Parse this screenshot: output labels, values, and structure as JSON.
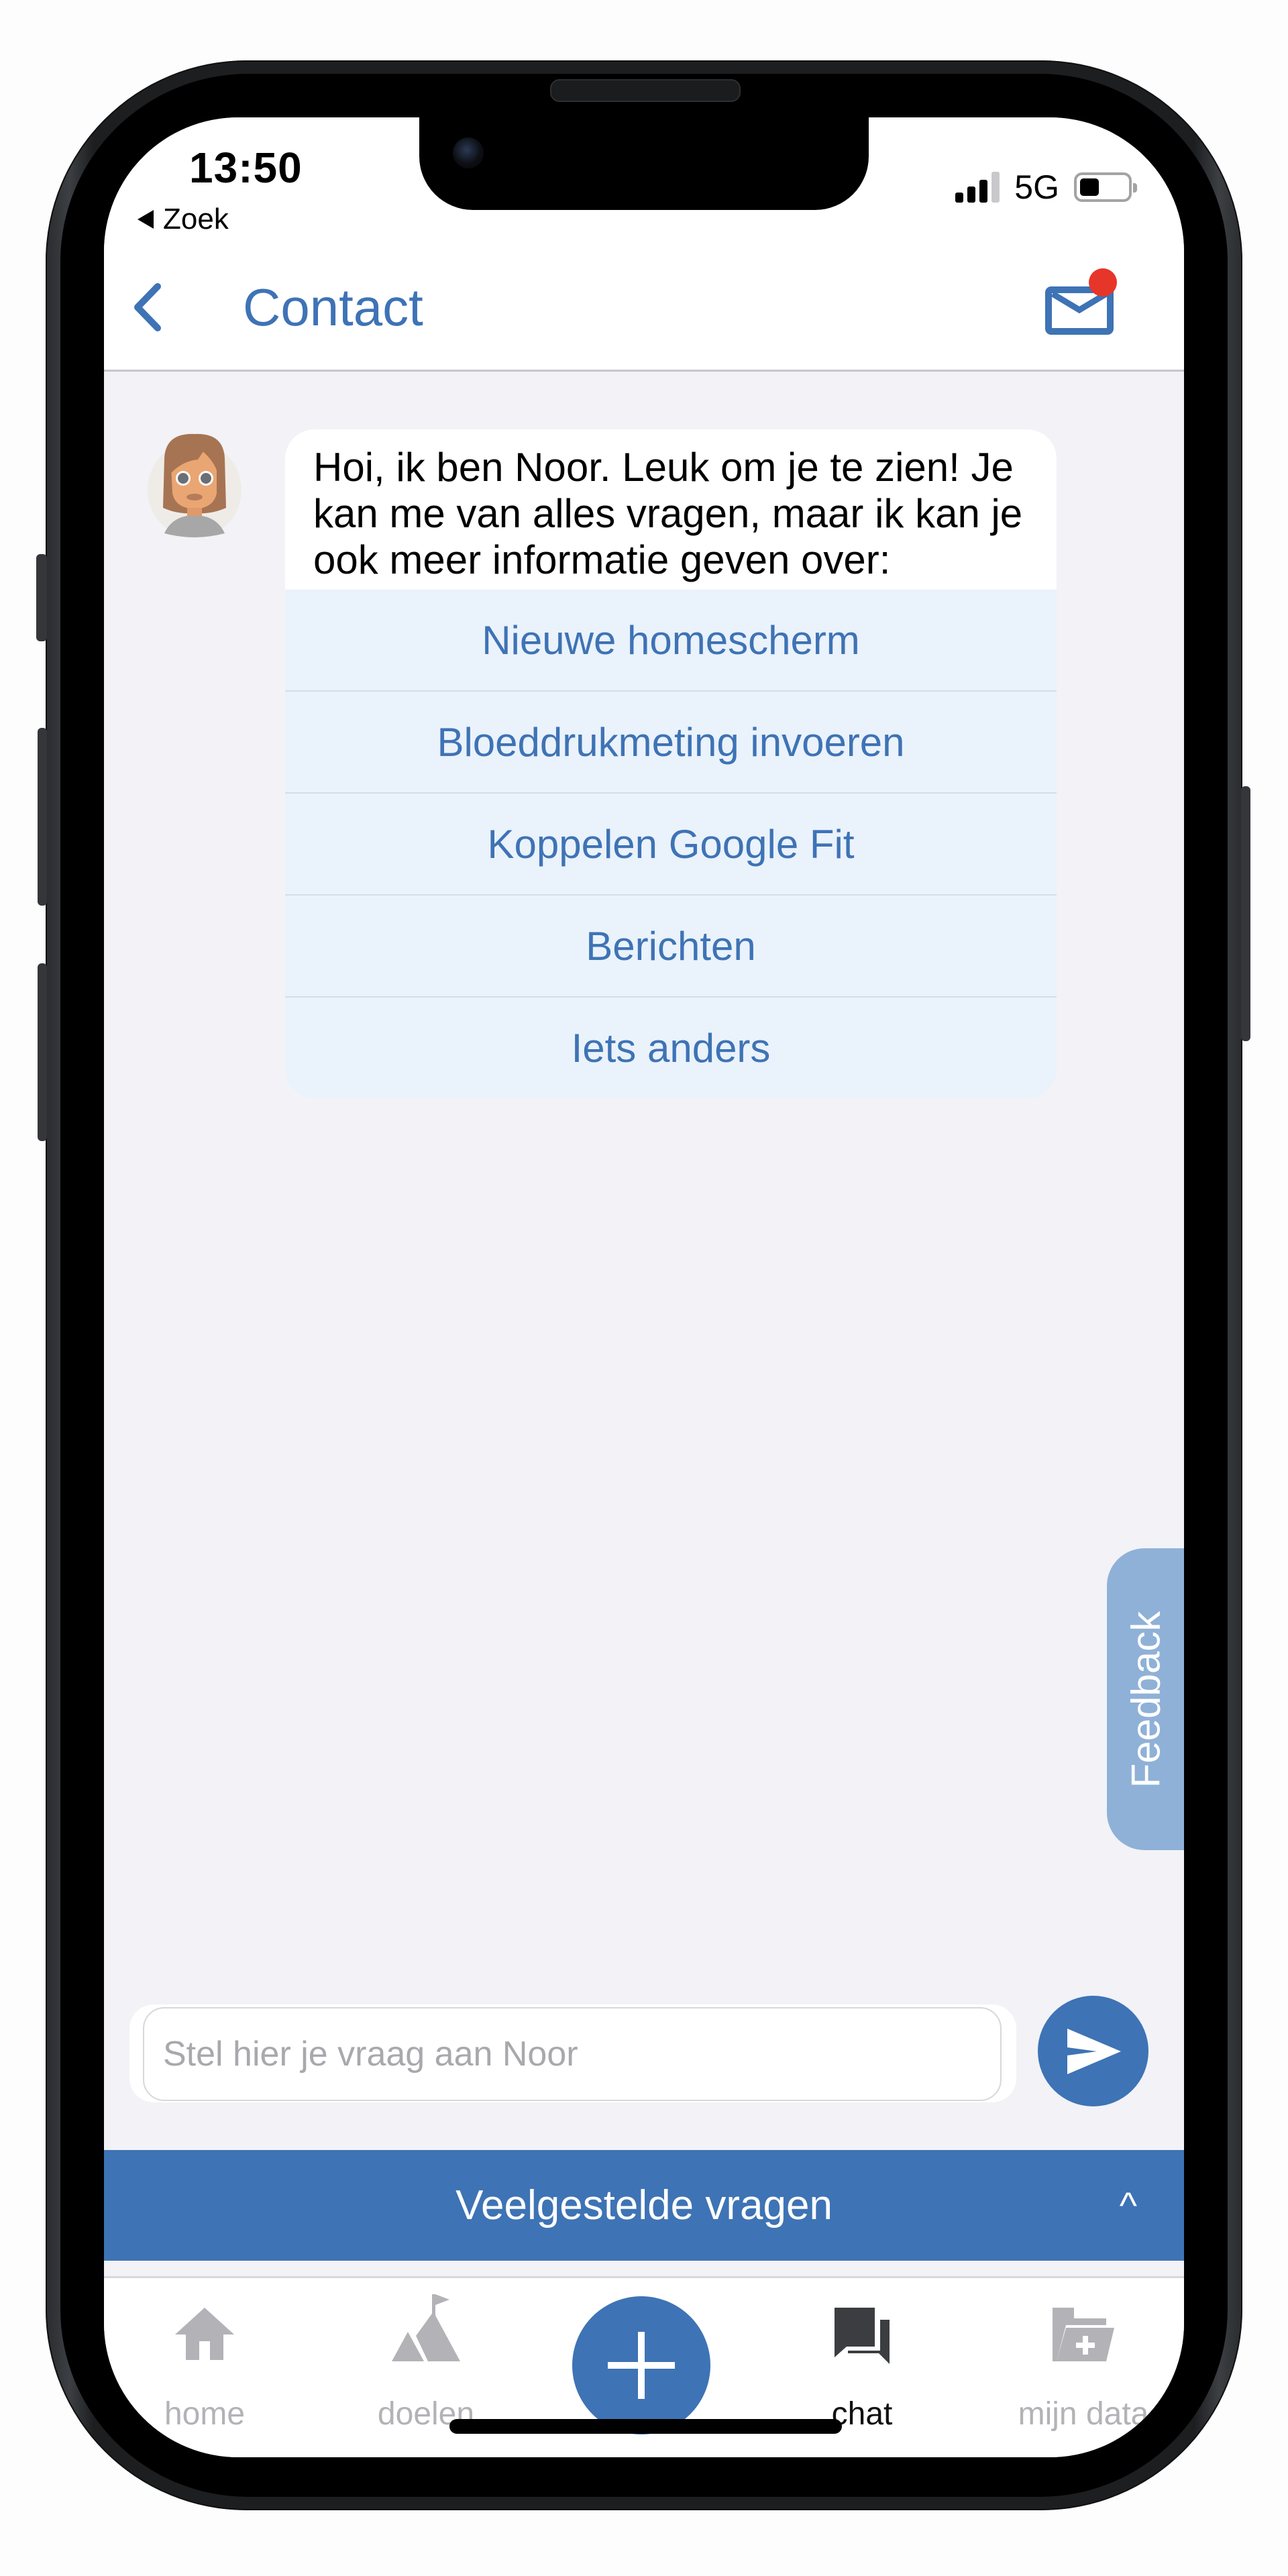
{
  "status_bar": {
    "time": "13:50",
    "back_app_label": "Zoek",
    "network": "5G",
    "signal_bars_active": 3,
    "signal_bars_total": 4,
    "battery_level_fraction": 0.4
  },
  "header": {
    "title": "Contact",
    "back_icon": "chevron-left-icon",
    "mail_icon": "mail-icon",
    "mail_has_notification": true
  },
  "chat": {
    "bot_name": "Noor",
    "messages": [
      {
        "sender": "bot",
        "text": "Hoi, ik ben Noor. Leuk om je te zien! Je kan me van alles vragen, maar ik kan je ook meer informatie geven over:",
        "options": [
          {
            "label": "Nieuwe homescherm"
          },
          {
            "label": "Bloeddrukmeting invoeren"
          },
          {
            "label": "Koppelen Google Fit"
          },
          {
            "label": "Berichten"
          },
          {
            "label": "Iets anders"
          }
        ]
      }
    ],
    "feedback_label": "Feedback",
    "input": {
      "value": "",
      "placeholder": "Stel hier je vraag aan Noor"
    },
    "send_icon": "send-icon"
  },
  "faq": {
    "label": "Veelgestelde vragen",
    "chevron": "^"
  },
  "tab_bar": {
    "items": [
      {
        "label": "home",
        "icon": "home-icon",
        "active": false
      },
      {
        "label": "doelen",
        "icon": "mountain-flag-icon",
        "active": false
      },
      {
        "label": "",
        "icon": "plus-icon",
        "active": false
      },
      {
        "label": "chat",
        "icon": "chat-bubbles-icon",
        "active": true
      },
      {
        "label": "mijn data",
        "icon": "folder-plus-icon",
        "active": false
      }
    ]
  },
  "colors": {
    "primary": "#3e73b5",
    "option_bg": "#eaf2fb",
    "screen_bg": "#f2f2f7",
    "badge": "#e6362a",
    "feedback_tab": "#8fb1d7",
    "inactive_tab": "#b2b2b7"
  }
}
